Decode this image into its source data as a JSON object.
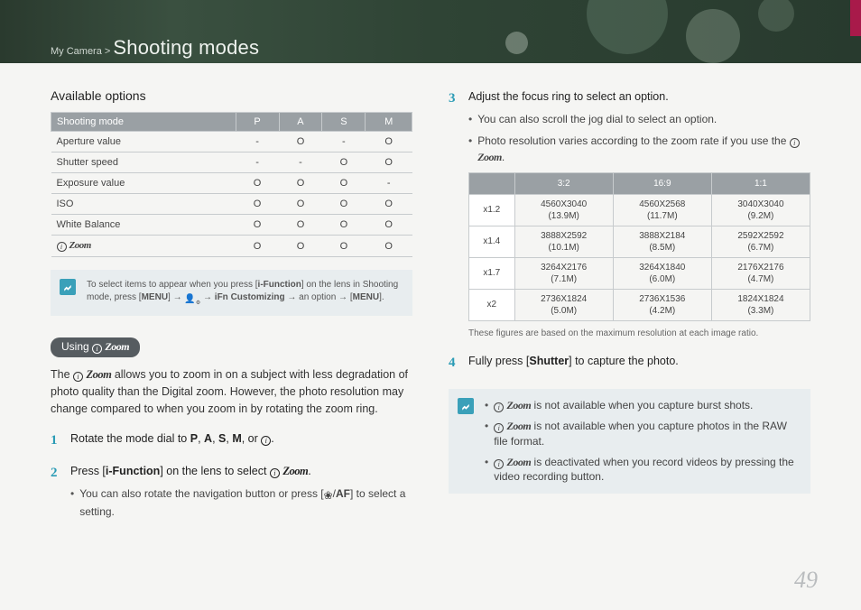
{
  "breadcrumb": {
    "prefix": "My Camera >",
    "title": "Shooting modes"
  },
  "left": {
    "available_heading": "Available options",
    "table_header": [
      "Shooting mode",
      "P",
      "A",
      "S",
      "M"
    ],
    "table_rows": [
      {
        "label": "Aperture value",
        "cells": [
          "-",
          "O",
          "-",
          "O"
        ]
      },
      {
        "label": "Shutter speed",
        "cells": [
          "-",
          "-",
          "O",
          "O"
        ]
      },
      {
        "label": "Exposure value",
        "cells": [
          "O",
          "O",
          "O",
          "-"
        ]
      },
      {
        "label": "ISO",
        "cells": [
          "O",
          "O",
          "O",
          "O"
        ]
      },
      {
        "label": "White Balance",
        "cells": [
          "O",
          "O",
          "O",
          "O"
        ]
      },
      {
        "label": "__IZOOM__",
        "cells": [
          "O",
          "O",
          "O",
          "O"
        ]
      }
    ],
    "note_line1": "To select items to appear when you press [",
    "note_ifn": "i-Function",
    "note_line1b": "] on the lens in Shooting mode, press [",
    "note_menu": "MENU",
    "note_line1c": "] → ",
    "note_ifn_cust": "iFn Customizing",
    "note_line1d": " → an option → [",
    "note_line1e": "].",
    "using_label": "Using ",
    "body": "The __IZOOM__ allows you to zoom in on a subject with less degradation of photo quality than the Digital zoom. However, the photo resolution may change compared to when you zoom in by rotating the zoom ring.",
    "step1": "Rotate the mode dial to ",
    "step1_modes": [
      "P",
      "A",
      "S",
      "M"
    ],
    "step1_suffix": ", or ",
    "step2a": "Press [",
    "step2b": "i-Function",
    "step2c": "] on the lens to select ",
    "step2_sub": "You can also rotate the navigation button or press [",
    "step2_sub_b": "] to select a setting.",
    "af_label": "AF"
  },
  "right": {
    "step3": "Adjust the focus ring to select an option.",
    "step3_sub1": "You can also scroll the jog dial to select an option.",
    "step3_sub2a": "Photo resolution varies according to the zoom rate if you use the ",
    "res_header": [
      "",
      "3:2",
      "16:9",
      "1:1"
    ],
    "res_rows": [
      {
        "label": "x1.2",
        "cells": [
          "4560X3040 (13.9M)",
          "4560X2568 (11.7M)",
          "3040X3040 (9.2M)"
        ]
      },
      {
        "label": "x1.4",
        "cells": [
          "3888X2592 (10.1M)",
          "3888X2184 (8.5M)",
          "2592X2592 (6.7M)"
        ]
      },
      {
        "label": "x1.7",
        "cells": [
          "3264X2176 (7.1M)",
          "3264X1840 (6.0M)",
          "2176X2176 (4.7M)"
        ]
      },
      {
        "label": "x2",
        "cells": [
          "2736X1824 (5.0M)",
          "2736X1536 (4.2M)",
          "1824X1824 (3.3M)"
        ]
      }
    ],
    "caption": "These figures are based on the maximum resolution at each image ratio.",
    "step4a": "Fully press [",
    "step4b": "Shutter",
    "step4c": "] to capture the photo.",
    "note2_a": " is not available when you capture burst shots.",
    "note2_b": " is not available when you capture photos in the RAW file format.",
    "note2_c": " is deactivated when you record videos by pressing the video recording button."
  },
  "page_number": "49"
}
